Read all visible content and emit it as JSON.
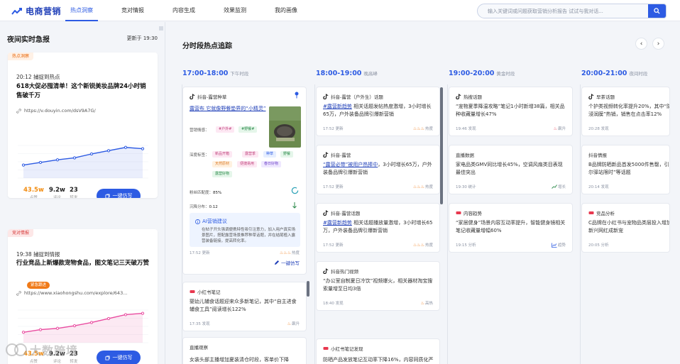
{
  "app": {
    "name": "电商营销"
  },
  "nav": [
    {
      "label": "热点洞察",
      "active": true
    },
    {
      "label": "竞对情报"
    },
    {
      "label": "内容生成"
    },
    {
      "label": "效果监测"
    },
    {
      "label": "我的画像"
    }
  ],
  "search": {
    "placeholder": "输入关键词或问题获取营销分析报告 试试与我对话..."
  },
  "left": {
    "title": "夜间实时急报",
    "updated": "更新于 19:30",
    "cards": [
      {
        "tag": "热点洞察",
        "time": "20:12 捕捉到热点",
        "title": "618大促必囤清单！这个新锐美妆品牌24小时销售破千万",
        "link": "https://v.douyin.com/dsV9A7G/",
        "trend": [
          20,
          24,
          28,
          31,
          37,
          42,
          47,
          45
        ],
        "stats": [
          {
            "value": "43.5w",
            "label": "点赞"
          },
          {
            "value": "9.2w",
            "label": "评论"
          },
          {
            "value": "23",
            "label": "转发"
          }
        ],
        "button": "一键仿写"
      },
      {
        "tag": "竞对情报",
        "time": "19:38 捕捉到情报",
        "title": "行业竞品上新爆款宠物食品，图文笔记三天破万赞",
        "badge": "紧急跟进",
        "link": "https://www.xiaohongshu.com/explore/643...",
        "trend": [
          16,
          20,
          22,
          26,
          31,
          37,
          43,
          45
        ],
        "stats": [
          {
            "value": "43.5w",
            "label": "点赞"
          },
          {
            "value": "9.2w",
            "label": "评论"
          },
          {
            "value": "23",
            "label": "转发"
          }
        ],
        "button": "一键仿写"
      }
    ]
  },
  "main": {
    "title": "分时段热点追踪",
    "prev": "‹",
    "next": "›",
    "columns": [
      {
        "time": "17:00-18:00",
        "sub": "下午时段",
        "cards": [
          {
            "source": "抖音-露营种草",
            "text_pre": "",
            "highlight": "露营布 它就像野餐垫界的“小精灵”",
            "text_post": "",
            "labels": {
              "emotion": "营销情感：",
              "tags": "深度标签：",
              "match": "粉丝匹配度：",
              "match_value": "85%",
              "spread": "沉降分布：",
              "spread_value": "0.12"
            },
            "emotion_chips": [
              "#户外#",
              "#野餐#"
            ],
            "tags": [
              "新品开箱",
              "露营季",
              "种草",
              "野餐",
              "天然原材",
              "便捷易用",
              "春日好物",
              "露营好物"
            ],
            "ai_title": "AI营销建议",
            "ai_text": "在帖子开头强调便携特性吸引注意力，加入用户真实场景图片，搭配露营场景推荐种草话题，并在结尾植入露营装备链接，提高转化率。",
            "time": "17:52 更新",
            "heat": "热度",
            "copy": "一键仿写"
          },
          {
            "source": "小红书笔记",
            "text": "婴幼儿辅食话题迎来众多新笔记，其中“自主进食辅食工具”阅读增长122%",
            "time": "17:35 发现",
            "heat": "飙升"
          },
          {
            "source": "直播观察",
            "text": "女装头部主播增加夏装清仓时段，客单价下降"
          }
        ]
      },
      {
        "time": "18:00-19:00",
        "sub": "晚高峰",
        "cards": [
          {
            "source": "抖音-露营（户外生）话题",
            "highlight": "#露营新趋势",
            "text_post": " 相关话题发帖热度激增，3小时增长65万，户外装备品牌引爆新营销",
            "time": "17:52 更新",
            "heat": "热度"
          },
          {
            "source": "抖音-露营",
            "highlight": "“露营必带”被用户热捧中",
            "text_post": "，3小时增长65万，户外装备品牌引爆新营销",
            "time": "17:52 更新",
            "heat": "热度"
          },
          {
            "source": "抖音-露营话题",
            "highlight": "#露营新趋势",
            "text_post": " 相关话题播放量激增，3小时增长65万，户外装备品牌引爆新营销",
            "time": "17:52 更新",
            "heat": "热度"
          },
          {
            "source": "抖音热门视频",
            "text": "“办公室自制夏日冷饮”视频爆火，相关器材淘宝搜索量增至日均3倍",
            "time": "18:40 发现",
            "heat": "高热"
          },
          {
            "source": "小红书笔记发现",
            "text": "防晒产品发放笔记互动率下降16%，内容同质化严"
          }
        ]
      },
      {
        "time": "19:00-20:00",
        "sub": "黄金时段",
        "cards": [
          {
            "source": "热搜话题",
            "text": "“宠物夏季降温攻略”笔记1小时新增38篇，相关品种收藏量增长47%",
            "time": "19:46 发现",
            "heat": "飙升"
          },
          {
            "source": "直播数据",
            "text": "家电品类GMV同比增长45%，空调风扇类目表现最佳突出",
            "time": "19:30 统计",
            "heat": "增长"
          },
          {
            "source": "内容趋势",
            "text": "“家居健身”场景内容互动率提升，智能健身镜相关笔记收藏量增幅60%",
            "time": "19:15 分析",
            "heat": "趋势"
          }
        ]
      },
      {
        "time": "20:00-21:00",
        "sub": "夜间时段",
        "cards": [
          {
            "source": "早茶话题",
            "text": "个护类视频转化率提升20%，其中“防晒衣”“去浸润膜”热销，销售在点击率12%",
            "time": "20:28 发现",
            "heat": ""
          },
          {
            "source": "抖音情报",
            "text": "B品牌防晒新品首发5000件售罄，引发用户“卡尔驿站限时”等话题",
            "time": "20:14 发现",
            "heat": ""
          },
          {
            "source": "竞品分析",
            "text": "C品牌在小红书与宠物品类层投入增加361%，新兴网红成新宠",
            "time": "20:05 分析",
            "heat": ""
          }
        ]
      }
    ]
  },
  "watermark": "大数跨境",
  "colors": {
    "primary": "#2d5be3",
    "orange": "#f28c10",
    "pink": "#e94ca0"
  }
}
